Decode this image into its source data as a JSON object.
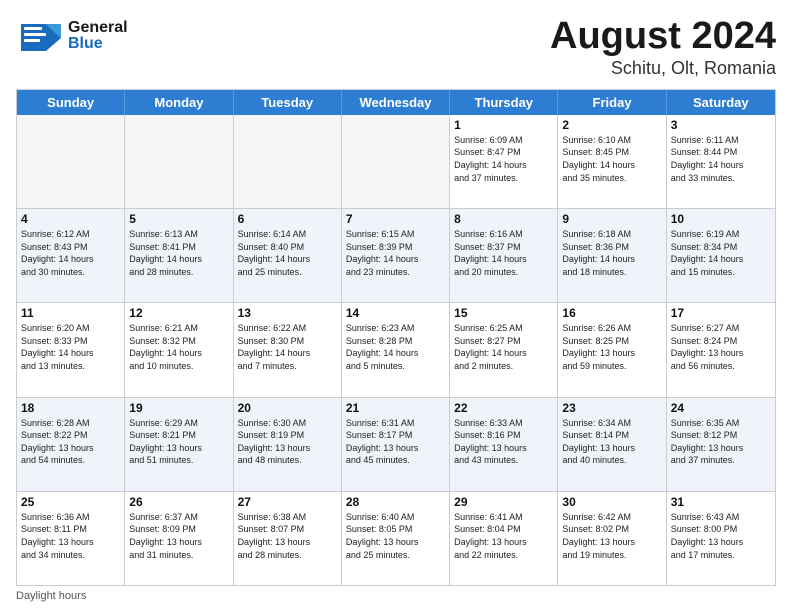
{
  "header": {
    "logo_general": "General",
    "logo_blue": "Blue",
    "month": "August 2024",
    "location": "Schitu, Olt, Romania"
  },
  "days_of_week": [
    "Sunday",
    "Monday",
    "Tuesday",
    "Wednesday",
    "Thursday",
    "Friday",
    "Saturday"
  ],
  "footer": {
    "label": "Daylight hours"
  },
  "weeks": [
    [
      {
        "day": "",
        "info": ""
      },
      {
        "day": "",
        "info": ""
      },
      {
        "day": "",
        "info": ""
      },
      {
        "day": "",
        "info": ""
      },
      {
        "day": "1",
        "info": "Sunrise: 6:09 AM\nSunset: 8:47 PM\nDaylight: 14 hours\nand 37 minutes."
      },
      {
        "day": "2",
        "info": "Sunrise: 6:10 AM\nSunset: 8:45 PM\nDaylight: 14 hours\nand 35 minutes."
      },
      {
        "day": "3",
        "info": "Sunrise: 6:11 AM\nSunset: 8:44 PM\nDaylight: 14 hours\nand 33 minutes."
      }
    ],
    [
      {
        "day": "4",
        "info": "Sunrise: 6:12 AM\nSunset: 8:43 PM\nDaylight: 14 hours\nand 30 minutes."
      },
      {
        "day": "5",
        "info": "Sunrise: 6:13 AM\nSunset: 8:41 PM\nDaylight: 14 hours\nand 28 minutes."
      },
      {
        "day": "6",
        "info": "Sunrise: 6:14 AM\nSunset: 8:40 PM\nDaylight: 14 hours\nand 25 minutes."
      },
      {
        "day": "7",
        "info": "Sunrise: 6:15 AM\nSunset: 8:39 PM\nDaylight: 14 hours\nand 23 minutes."
      },
      {
        "day": "8",
        "info": "Sunrise: 6:16 AM\nSunset: 8:37 PM\nDaylight: 14 hours\nand 20 minutes."
      },
      {
        "day": "9",
        "info": "Sunrise: 6:18 AM\nSunset: 8:36 PM\nDaylight: 14 hours\nand 18 minutes."
      },
      {
        "day": "10",
        "info": "Sunrise: 6:19 AM\nSunset: 8:34 PM\nDaylight: 14 hours\nand 15 minutes."
      }
    ],
    [
      {
        "day": "11",
        "info": "Sunrise: 6:20 AM\nSunset: 8:33 PM\nDaylight: 14 hours\nand 13 minutes."
      },
      {
        "day": "12",
        "info": "Sunrise: 6:21 AM\nSunset: 8:32 PM\nDaylight: 14 hours\nand 10 minutes."
      },
      {
        "day": "13",
        "info": "Sunrise: 6:22 AM\nSunset: 8:30 PM\nDaylight: 14 hours\nand 7 minutes."
      },
      {
        "day": "14",
        "info": "Sunrise: 6:23 AM\nSunset: 8:28 PM\nDaylight: 14 hours\nand 5 minutes."
      },
      {
        "day": "15",
        "info": "Sunrise: 6:25 AM\nSunset: 8:27 PM\nDaylight: 14 hours\nand 2 minutes."
      },
      {
        "day": "16",
        "info": "Sunrise: 6:26 AM\nSunset: 8:25 PM\nDaylight: 13 hours\nand 59 minutes."
      },
      {
        "day": "17",
        "info": "Sunrise: 6:27 AM\nSunset: 8:24 PM\nDaylight: 13 hours\nand 56 minutes."
      }
    ],
    [
      {
        "day": "18",
        "info": "Sunrise: 6:28 AM\nSunset: 8:22 PM\nDaylight: 13 hours\nand 54 minutes."
      },
      {
        "day": "19",
        "info": "Sunrise: 6:29 AM\nSunset: 8:21 PM\nDaylight: 13 hours\nand 51 minutes."
      },
      {
        "day": "20",
        "info": "Sunrise: 6:30 AM\nSunset: 8:19 PM\nDaylight: 13 hours\nand 48 minutes."
      },
      {
        "day": "21",
        "info": "Sunrise: 6:31 AM\nSunset: 8:17 PM\nDaylight: 13 hours\nand 45 minutes."
      },
      {
        "day": "22",
        "info": "Sunrise: 6:33 AM\nSunset: 8:16 PM\nDaylight: 13 hours\nand 43 minutes."
      },
      {
        "day": "23",
        "info": "Sunrise: 6:34 AM\nSunset: 8:14 PM\nDaylight: 13 hours\nand 40 minutes."
      },
      {
        "day": "24",
        "info": "Sunrise: 6:35 AM\nSunset: 8:12 PM\nDaylight: 13 hours\nand 37 minutes."
      }
    ],
    [
      {
        "day": "25",
        "info": "Sunrise: 6:36 AM\nSunset: 8:11 PM\nDaylight: 13 hours\nand 34 minutes."
      },
      {
        "day": "26",
        "info": "Sunrise: 6:37 AM\nSunset: 8:09 PM\nDaylight: 13 hours\nand 31 minutes."
      },
      {
        "day": "27",
        "info": "Sunrise: 6:38 AM\nSunset: 8:07 PM\nDaylight: 13 hours\nand 28 minutes."
      },
      {
        "day": "28",
        "info": "Sunrise: 6:40 AM\nSunset: 8:05 PM\nDaylight: 13 hours\nand 25 minutes."
      },
      {
        "day": "29",
        "info": "Sunrise: 6:41 AM\nSunset: 8:04 PM\nDaylight: 13 hours\nand 22 minutes."
      },
      {
        "day": "30",
        "info": "Sunrise: 6:42 AM\nSunset: 8:02 PM\nDaylight: 13 hours\nand 19 minutes."
      },
      {
        "day": "31",
        "info": "Sunrise: 6:43 AM\nSunset: 8:00 PM\nDaylight: 13 hours\nand 17 minutes."
      }
    ]
  ]
}
